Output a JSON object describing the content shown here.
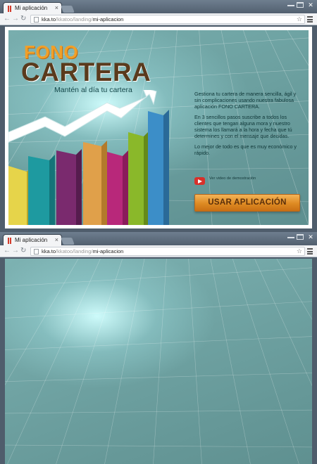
{
  "browser": {
    "tab_title": "Mi aplicación",
    "tab_close": "×",
    "url_host": "kka.to",
    "url_mid": "/kkatoo/landing/",
    "url_last": "mi-aplicacion",
    "close_glyph": "✕",
    "back_glyph": "←",
    "forward_glyph": "→",
    "reload_glyph": "↻",
    "star_glyph": "☆"
  },
  "landing": {
    "logo_top": "FONO",
    "logo_bottom": "CARTERA",
    "tagline": "Mantén al día tu cartera",
    "paragraphs": [
      "Gestiona tu cartera de manera sencilla, ágil y sin complicaciones usando nuestra fabulosa aplicación FONO CARTERA.",
      "En 3 sencillos pasos suscribe a todos los clientes que tengan alguna mora y nuestro sistema los llamará a la hora y fecha que tú determines y con el mensaje que decidas.",
      "Lo mejor de todo es que es muy económico y rápido."
    ],
    "video_label": "Ver video de demostración",
    "cta_label": "USAR APLICACIÓN"
  },
  "colors": {
    "accent_orange": "#f0a02a",
    "brand_brown": "#5a3a1c",
    "youtube_red": "#d8302a",
    "bar_colors": [
      "#e6d44a",
      "#1e9aa0",
      "#7a2a6e",
      "#e0a04a",
      "#b8287a",
      "#8ab82a",
      "#3c8ec8"
    ]
  },
  "icons": {
    "favicon": "red-bars-favicon-icon",
    "page": "page-icon",
    "youtube": "youtube-play-icon",
    "menu": "hamburger-menu-icon"
  }
}
